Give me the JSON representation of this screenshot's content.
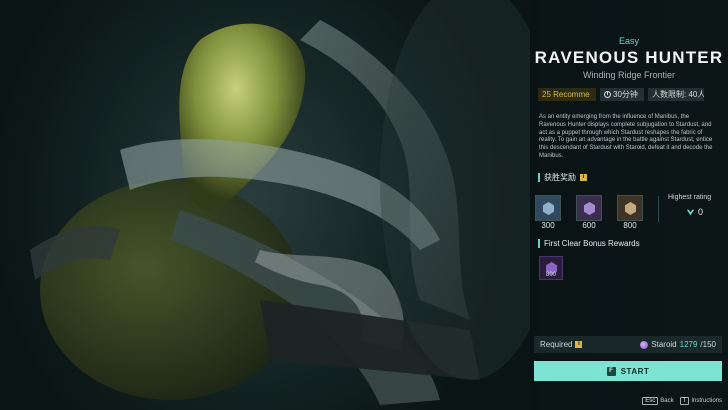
{
  "boss": {
    "difficulty": "Easy",
    "name": "RAVENOUS HUNTER",
    "location": "Winding Ridge Frontier",
    "level_chip": "25  Recomme",
    "time_chip": "30分钟",
    "players_chip": "人数限制: 40人",
    "description": "As an entity emerging from the influence of Manibus, the Ravenous Hunter displays complete subjugation to Stardust, and act as a puppet through which Stardust reshapes the fabric of reality. To gain an advantage in the battle against Stardust, entice this descendant of Stardust with Staroid, defeat it and decode the Manibus."
  },
  "rewards": {
    "title": "获胜奖励",
    "info_glyph": "i",
    "items": [
      {
        "value": "300",
        "color": "#2f4a5e",
        "gem_color": "#8fb0c9",
        "icon": "gem-icon"
      },
      {
        "value": "600",
        "color": "#3a2d4e",
        "gem_color": "#a58ad1",
        "icon": "gem-icon"
      },
      {
        "value": "800",
        "color": "#3e3426",
        "gem_color": "#c4a980",
        "icon": "gem-icon"
      }
    ],
    "highest_rating_label": "Highest rating",
    "highest_rating_value": "0"
  },
  "first_clear": {
    "title": "First Clear Bonus Rewards",
    "value": "800",
    "icon": "purple-gem-icon"
  },
  "requirement": {
    "label": "Required",
    "info_glyph": "i",
    "currency": "Staroid",
    "stock": "1279",
    "needed": "/150"
  },
  "start": {
    "key": "F",
    "label": "START"
  },
  "footer": {
    "back_key": "Esc",
    "back_label": "Back",
    "instructions_key": "T",
    "instructions_label": "Instructions"
  },
  "colors": {
    "accent": "#7de3d2",
    "gold": "#d9b747",
    "teal_text": "#6fcfc7"
  }
}
